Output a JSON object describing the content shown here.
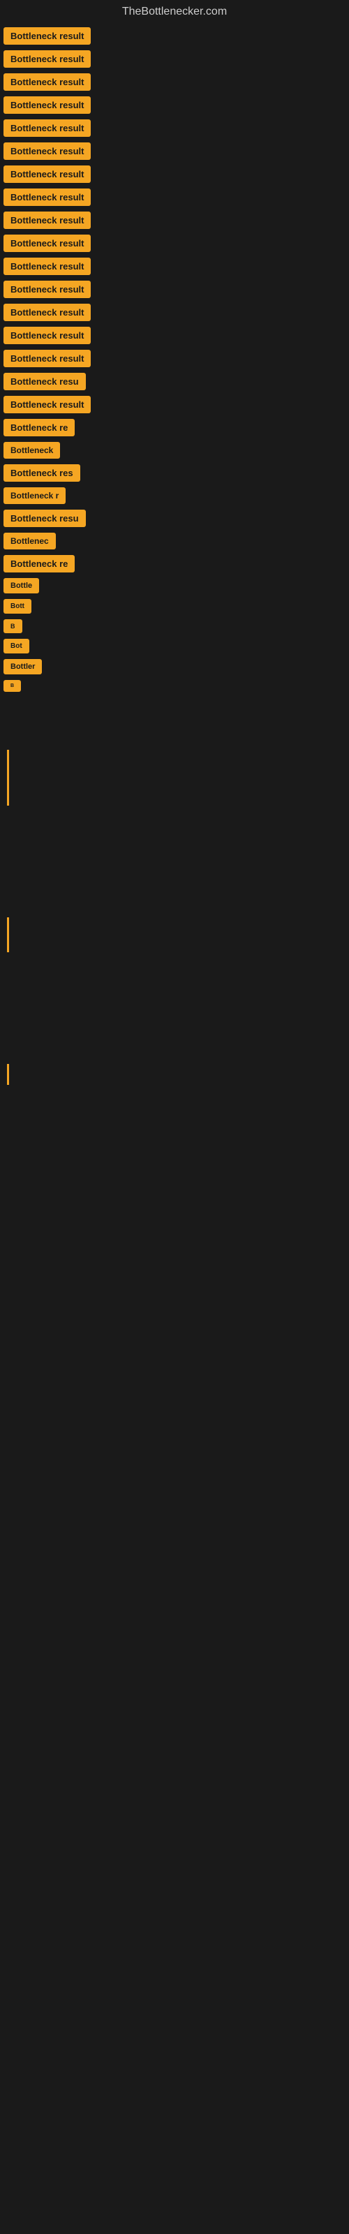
{
  "site": {
    "title": "TheBottlenecker.com"
  },
  "items": [
    {
      "label": "Bottleneck result",
      "size": "full"
    },
    {
      "label": "Bottleneck result",
      "size": "full"
    },
    {
      "label": "Bottleneck result",
      "size": "full"
    },
    {
      "label": "Bottleneck result",
      "size": "full"
    },
    {
      "label": "Bottleneck result",
      "size": "full"
    },
    {
      "label": "Bottleneck result",
      "size": "full"
    },
    {
      "label": "Bottleneck result",
      "size": "full"
    },
    {
      "label": "Bottleneck result",
      "size": "full"
    },
    {
      "label": "Bottleneck result",
      "size": "full"
    },
    {
      "label": "Bottleneck result",
      "size": "full"
    },
    {
      "label": "Bottleneck result",
      "size": "full"
    },
    {
      "label": "Bottleneck result",
      "size": "full"
    },
    {
      "label": "Bottleneck result",
      "size": "full"
    },
    {
      "label": "Bottleneck result",
      "size": "full"
    },
    {
      "label": "Bottleneck result",
      "size": "full"
    },
    {
      "label": "Bottleneck resu",
      "size": "lg"
    },
    {
      "label": "Bottleneck result",
      "size": "full"
    },
    {
      "label": "Bottleneck re",
      "size": "md"
    },
    {
      "label": "Bottleneck",
      "size": "sm"
    },
    {
      "label": "Bottleneck res",
      "size": "md"
    },
    {
      "label": "Bottleneck r",
      "size": "sm"
    },
    {
      "label": "Bottleneck resu",
      "size": "lg"
    },
    {
      "label": "Bottlenec",
      "size": "sm"
    },
    {
      "label": "Bottleneck re",
      "size": "md"
    },
    {
      "label": "Bottle",
      "size": "xs"
    },
    {
      "label": "Bott",
      "size": "xxs"
    },
    {
      "label": "B",
      "size": "tiny"
    },
    {
      "label": "Bot",
      "size": "xxs"
    },
    {
      "label": "Bottler",
      "size": "xs"
    },
    {
      "label": "B",
      "size": "micro"
    }
  ],
  "bars": [
    {
      "size": "tall"
    },
    {
      "size": "medium"
    },
    {
      "size": "short"
    }
  ]
}
